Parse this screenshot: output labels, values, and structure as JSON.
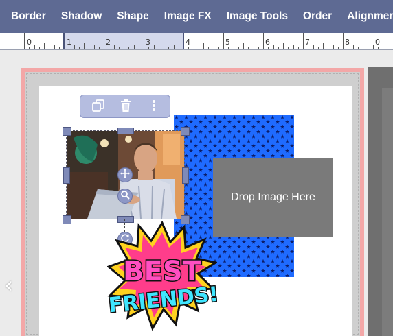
{
  "menu": {
    "items": [
      "Border",
      "Shadow",
      "Shape",
      "Image FX",
      "Image Tools",
      "Order",
      "Alignment"
    ]
  },
  "ruler": {
    "labels": [
      "0",
      "1",
      "2",
      "3",
      "4",
      "5",
      "6",
      "7",
      "8",
      "0"
    ]
  },
  "canvas": {
    "dropzone_label": "Drop Image Here",
    "sticker_line1": "BEST",
    "sticker_line2": "FRIENDS!"
  },
  "icons": {
    "duplicate": "duplicate-icon",
    "delete": "trash-icon",
    "more": "more-vertical-icon",
    "move": "move-icon",
    "zoom": "zoom-icon",
    "rotate": "rotate-icon",
    "prev": "chevron-left-icon"
  },
  "colors": {
    "menubar": "#5e6a93",
    "handle": "#7f8ab8",
    "pattern": "#1f6bff",
    "bleed": "#f3a7a7",
    "dropzone": "#7a7a7a"
  }
}
